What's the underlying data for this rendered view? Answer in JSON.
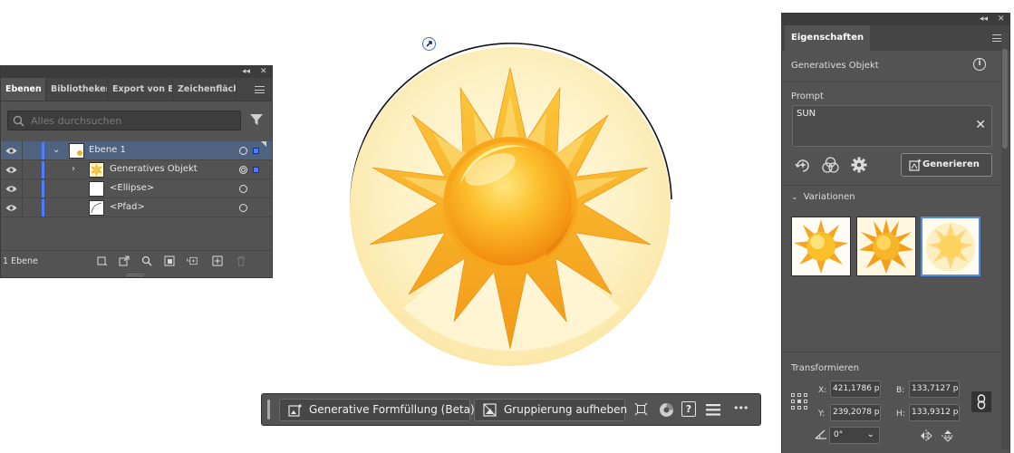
{
  "layers_panel": {
    "tabs": [
      "Ebenen",
      "Bibliotheken",
      "Export von El",
      "Zeichenfläche"
    ],
    "search_placeholder": "Alles durchsuchen",
    "rows": [
      {
        "label": "Ebene 1"
      },
      {
        "label": "Generatives Objekt"
      },
      {
        "label": "<Ellipse>"
      },
      {
        "label": "<Pfad>"
      }
    ],
    "footer_count": "1 Ebene",
    "collapse": "◂◂",
    "close": "✕"
  },
  "task_bar": {
    "generative_fill_label": "Generative Formfüllung (Beta)",
    "ungroup_label": "Gruppierung aufheben",
    "help_label": "?",
    "more_label": "•••"
  },
  "properties_panel": {
    "tab": "Eigenschaften",
    "object_type": "Generatives Objekt",
    "info": "i",
    "prompt_label": "Prompt",
    "prompt_value": "SUN",
    "clear": "✕",
    "generate_label": "Generieren",
    "variations_label": "Variationen",
    "transform_label": "Transformieren",
    "x_label": "X:",
    "x_value": "421,1786 p",
    "y_label": "Y:",
    "y_value": "239,2078 p",
    "w_label": "B:",
    "w_value": "133,7127 p",
    "h_label": "H:",
    "h_value": "133,9312 p",
    "angle_value": "0°",
    "collapse": "◂◂",
    "close": "✕"
  },
  "colors": {
    "panel_bg": "#535353",
    "selection": "#4f6380",
    "layer_color": "#4f7cff",
    "sun_orange": "#f5a623",
    "sun_yellow": "#fcd34d",
    "disc_bg": "#fdf3c8"
  }
}
